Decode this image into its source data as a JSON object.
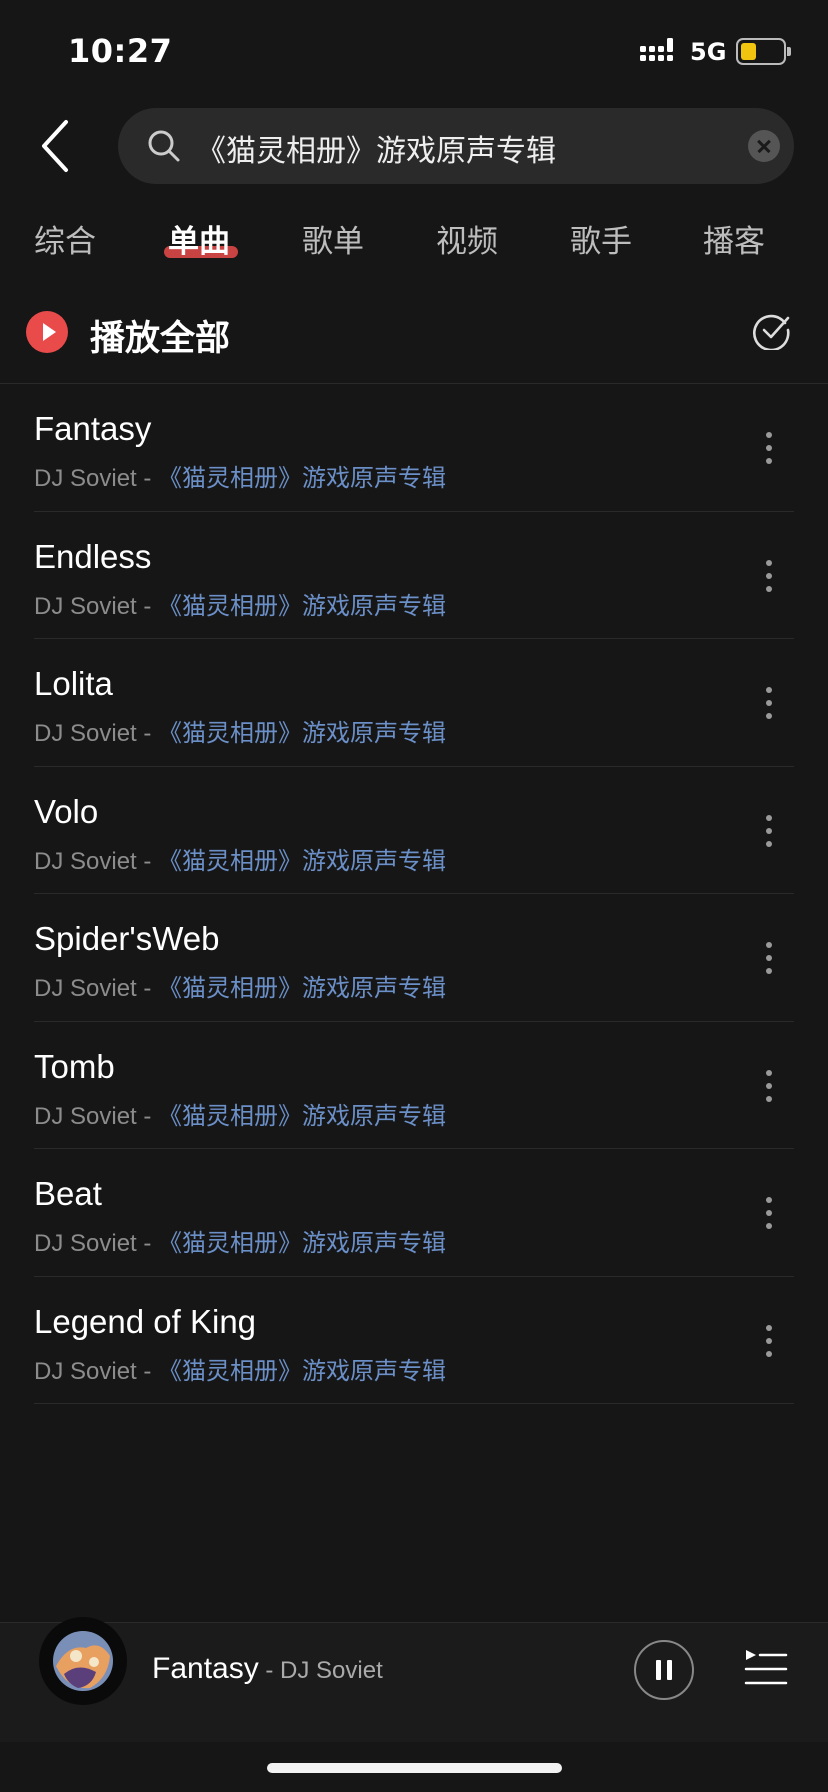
{
  "status_bar": {
    "time": "10:27",
    "network": "5G"
  },
  "search": {
    "query": "《猫灵相册》游戏原声专辑"
  },
  "tabs": [
    {
      "label": "综合",
      "active": false
    },
    {
      "label": "单曲",
      "active": true
    },
    {
      "label": "歌单",
      "active": false
    },
    {
      "label": "视频",
      "active": false
    },
    {
      "label": "歌手",
      "active": false
    },
    {
      "label": "播客",
      "active": false
    }
  ],
  "play_all": {
    "label": "播放全部"
  },
  "songs": [
    {
      "title": "Fantasy",
      "artist": "DJ Soviet - ",
      "album": "《猫灵相册》游戏原声专辑"
    },
    {
      "title": "Endless",
      "artist": "DJ Soviet - ",
      "album": "《猫灵相册》游戏原声专辑"
    },
    {
      "title": "Lolita",
      "artist": "DJ Soviet - ",
      "album": "《猫灵相册》游戏原声专辑"
    },
    {
      "title": "Volo",
      "artist": "DJ Soviet - ",
      "album": "《猫灵相册》游戏原声专辑"
    },
    {
      "title": "Spider'sWeb",
      "artist": "DJ Soviet - ",
      "album": "《猫灵相册》游戏原声专辑"
    },
    {
      "title": "Tomb",
      "artist": "DJ Soviet - ",
      "album": "《猫灵相册》游戏原声专辑"
    },
    {
      "title": "Beat",
      "artist": "DJ Soviet - ",
      "album": "《猫灵相册》游戏原声专辑"
    },
    {
      "title": "Legend of King",
      "artist": "DJ Soviet - ",
      "album": "《猫灵相册》游戏原声专辑"
    }
  ],
  "now_playing": {
    "title": "Fantasy",
    "artist": " - DJ Soviet"
  },
  "colors": {
    "accent": "#e94b4b",
    "album_link": "#6b8fc7",
    "background": "#161616",
    "battery": "#f1c40f"
  },
  "icons": {
    "back": "chevron-left-icon",
    "search": "search-icon",
    "clear": "close-icon",
    "play": "play-icon",
    "multi_select": "check-circle-icon",
    "more": "more-vertical-icon",
    "pause": "pause-icon",
    "queue": "playlist-icon"
  }
}
